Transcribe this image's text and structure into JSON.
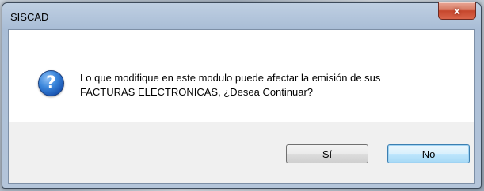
{
  "dialog": {
    "title": "SISCAD",
    "close_label": "x",
    "icon": "question-icon",
    "message_line1": "Lo que modifique en este modulo puede afectar la emisión de sus",
    "message_line2": "FACTURAS ELECTRONICAS, ¿Desea Continuar?",
    "yes_label": "Sí",
    "no_label": "No"
  }
}
